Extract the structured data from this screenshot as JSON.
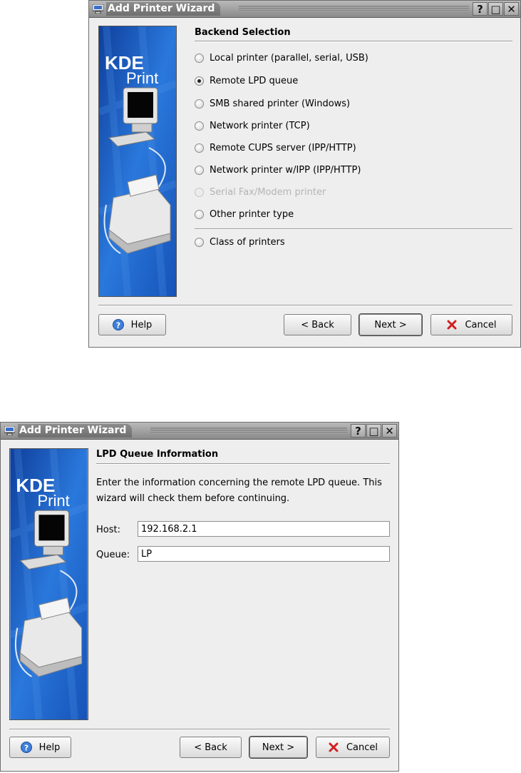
{
  "window1": {
    "title": "Add Printer Wizard",
    "title_buttons": [
      "?",
      "□",
      "✕"
    ],
    "banner": {
      "logo_main": "KDE",
      "logo_sub": "Print"
    },
    "section_title": "Backend Selection",
    "options": [
      {
        "label": "Local printer (parallel, serial, USB)",
        "checked": false,
        "enabled": true
      },
      {
        "label": "Remote LPD queue",
        "checked": true,
        "enabled": true
      },
      {
        "label": "SMB shared printer (Windows)",
        "checked": false,
        "enabled": true
      },
      {
        "label": "Network printer (TCP)",
        "checked": false,
        "enabled": true
      },
      {
        "label": "Remote CUPS server (IPP/HTTP)",
        "checked": false,
        "enabled": true
      },
      {
        "label": "Network printer w/IPP (IPP/HTTP)",
        "checked": false,
        "enabled": true
      },
      {
        "label": "Serial Fax/Modem printer",
        "checked": false,
        "enabled": false
      },
      {
        "label": "Other printer type",
        "checked": false,
        "enabled": true
      },
      {
        "label": "Class of printers",
        "checked": false,
        "enabled": true
      }
    ],
    "buttons": {
      "help": "Help",
      "back": "< Back",
      "next": "Next >",
      "cancel": "Cancel"
    }
  },
  "window2": {
    "title": "Add Printer Wizard",
    "title_buttons": [
      "?",
      "□",
      "✕"
    ],
    "banner": {
      "logo_main": "KDE",
      "logo_sub": "Print"
    },
    "section_title": "LPD Queue Information",
    "description": "Enter the information concerning the remote LPD queue. This wizard will check them before continuing.",
    "host": {
      "label": "Host:",
      "value": "192.168.2.1"
    },
    "queue": {
      "label": "Queue:",
      "value": "LP"
    },
    "buttons": {
      "help": "Help",
      "back": "< Back",
      "next": "Next >",
      "cancel": "Cancel"
    }
  },
  "colors": {
    "banner_blue": "#1c5fc2",
    "titlebar_gray": "#8a8a8a",
    "help_blue": "#3f7fd8",
    "cancel_red": "#d02020"
  },
  "icons": [
    "window-app-icon",
    "help-icon",
    "cancel-icon",
    "computer-monitor-icon",
    "printer-icon"
  ]
}
